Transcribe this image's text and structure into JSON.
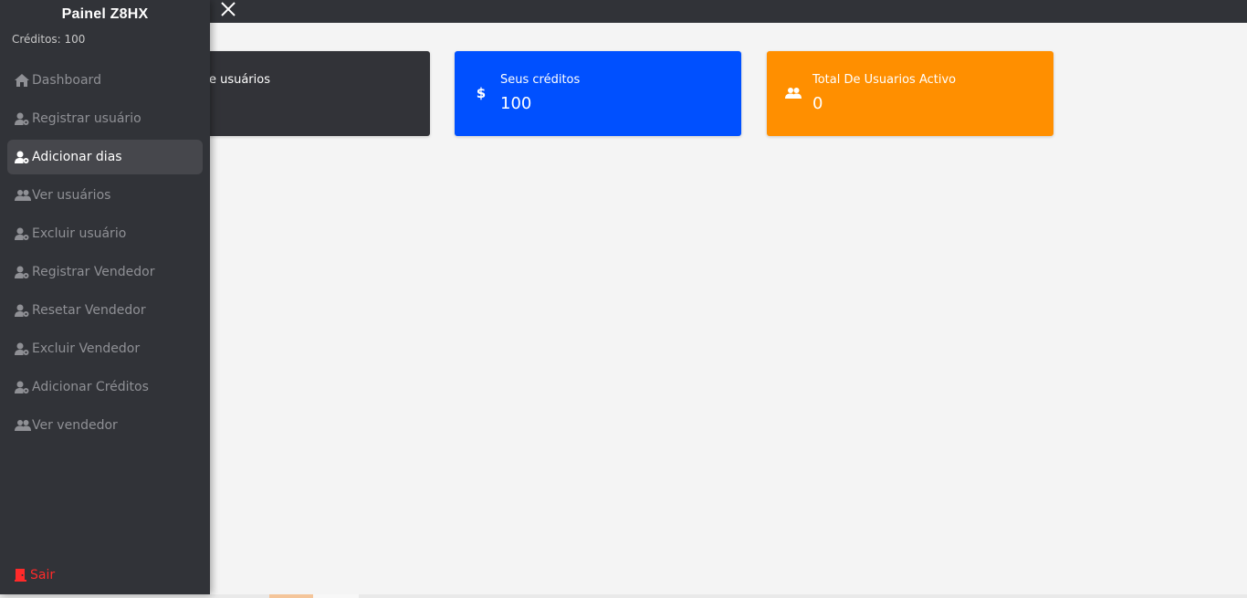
{
  "sidebar": {
    "brand": "Painel Z8HX",
    "credits": "Créditos: 100",
    "items": [
      {
        "label": "Dashboard",
        "icon": "home-icon",
        "active": false
      },
      {
        "label": "Registrar usuário",
        "icon": "user-gear-icon",
        "active": false
      },
      {
        "label": "Adicionar dias",
        "icon": "user-gear-icon",
        "active": true
      },
      {
        "label": "Ver usuários",
        "icon": "users-icon",
        "active": false
      },
      {
        "label": "Excluir usuário",
        "icon": "user-gear-icon",
        "active": false
      },
      {
        "label": "Registrar Vendedor",
        "icon": "user-gear-icon",
        "active": false
      },
      {
        "label": "Resetar Vendedor",
        "icon": "user-gear-icon",
        "active": false
      },
      {
        "label": "Excluir Vendedor",
        "icon": "user-gear-icon",
        "active": false
      },
      {
        "label": "Adicionar Créditos",
        "icon": "user-gear-icon",
        "active": false
      },
      {
        "label": "Ver vendedor",
        "icon": "users-icon",
        "active": false
      }
    ],
    "logout": {
      "label": "Sair",
      "icon": "door-icon",
      "color": "#ff2a2a"
    }
  },
  "topbar": {
    "close_icon": "close-icon"
  },
  "cards": [
    {
      "title": "al de usuários",
      "value": "",
      "icon": "",
      "color": "#323338"
    },
    {
      "title": "Seus créditos",
      "value": "100",
      "icon": "dollar-icon",
      "icon_glyph": "$",
      "color": "#0050ff"
    },
    {
      "title": "Total De Usuarios Activo",
      "value": "0",
      "icon": "users-icon",
      "color": "#ff8f00"
    }
  ]
}
